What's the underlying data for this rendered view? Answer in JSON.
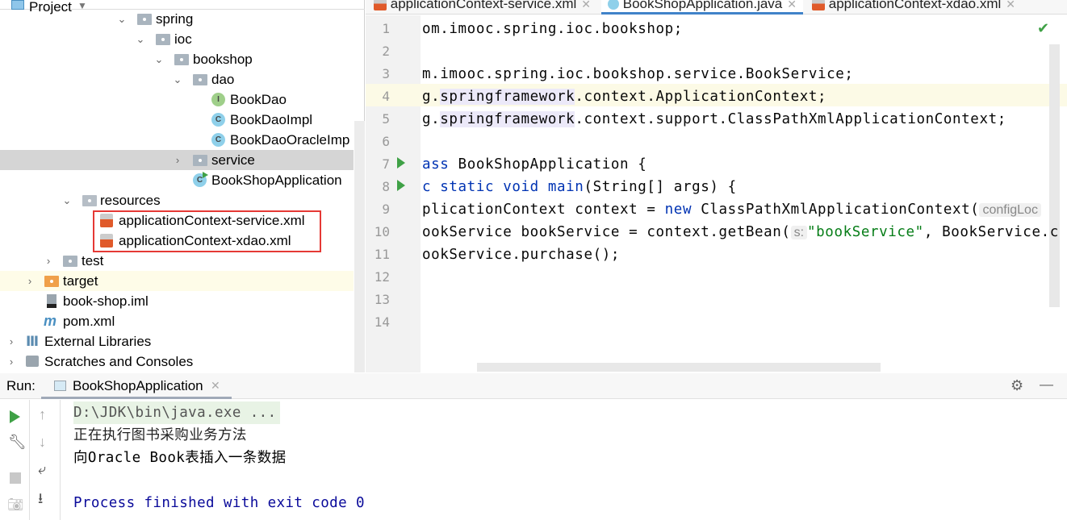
{
  "project_panel": {
    "title": "Project",
    "tree": [
      {
        "label": "spring",
        "type": "package",
        "expanded": true
      },
      {
        "label": "ioc",
        "type": "package",
        "expanded": true
      },
      {
        "label": "bookshop",
        "type": "package",
        "expanded": true
      },
      {
        "label": "dao",
        "type": "package",
        "expanded": true
      },
      {
        "label": "BookDao",
        "type": "interface",
        "badge": "I"
      },
      {
        "label": "BookDaoImpl",
        "type": "class",
        "badge": "C"
      },
      {
        "label": "BookDaoOracleImp",
        "type": "class",
        "badge": "C"
      },
      {
        "label": "service",
        "type": "package",
        "expanded": false
      },
      {
        "label": "BookShopApplication",
        "type": "main-class",
        "badge": "C"
      },
      {
        "label": "resources",
        "type": "folder",
        "expanded": true
      },
      {
        "label": "applicationContext-service.xml",
        "type": "xml"
      },
      {
        "label": "applicationContext-xdao.xml",
        "type": "xml"
      },
      {
        "label": "test",
        "type": "folder",
        "expanded": false
      },
      {
        "label": "target",
        "type": "folder-orange",
        "expanded": false
      },
      {
        "label": "book-shop.iml",
        "type": "iml"
      },
      {
        "label": "pom.xml",
        "type": "maven"
      },
      {
        "label": "External Libraries",
        "type": "libraries",
        "expanded": false
      },
      {
        "label": "Scratches and Consoles",
        "type": "scratches",
        "expanded": false
      }
    ]
  },
  "editor": {
    "tabs": [
      {
        "label": "applicationContext-service.xml",
        "active": false
      },
      {
        "label": "BookShopApplication.java",
        "active": true
      },
      {
        "label": "applicationContext-xdao.xml",
        "active": false
      }
    ],
    "line_numbers": [
      "1",
      "2",
      "3",
      "4",
      "5",
      "6",
      "7",
      "8",
      "9",
      "10",
      "11",
      "12",
      "13",
      "14"
    ],
    "lines": {
      "l1": "om.imooc.spring.ioc.bookshop;",
      "l3": "m.imooc.spring.ioc.bookshop.service.BookService;",
      "l4a": "g.",
      "l4b": "springframework",
      ".l4c": "",
      "l4c": ".context.ApplicationContext;",
      "l5a": "g.",
      "l5b": "springframework",
      "l5c": ".context.support.ClassPathXmlApplicationContext;",
      "l7a": "ass",
      "l7b": " BookShopApplication {",
      "l8a": "c static void main",
      "l8b": "(String[] args) {",
      "l9a": "plicationContext context = ",
      "l9b": "new",
      "l9c": " ClassPathXmlApplicationContext(",
      "l9hint": "configLoc",
      "l10a": "ookService bookService = context.getBean(",
      "l10hint": "s:",
      "l10str": "\"bookService\"",
      "l10c": ", BookService.c",
      "l11": "ookService.purchase();"
    },
    "status": "no-problems"
  },
  "run_panel": {
    "label": "Run:",
    "tab": "BookShopApplication",
    "output": [
      "D:\\JDK\\bin\\java.exe ...",
      "正在执行图书采购业务方法",
      "向Oracle Book表插入一条数据",
      "",
      "Process finished with exit code 0"
    ]
  },
  "colors": {
    "keyword": "#0033b3",
    "string": "#067d17",
    "accent": "#4083c9",
    "run": "#3fa146",
    "highlight_box": "#e53935"
  }
}
